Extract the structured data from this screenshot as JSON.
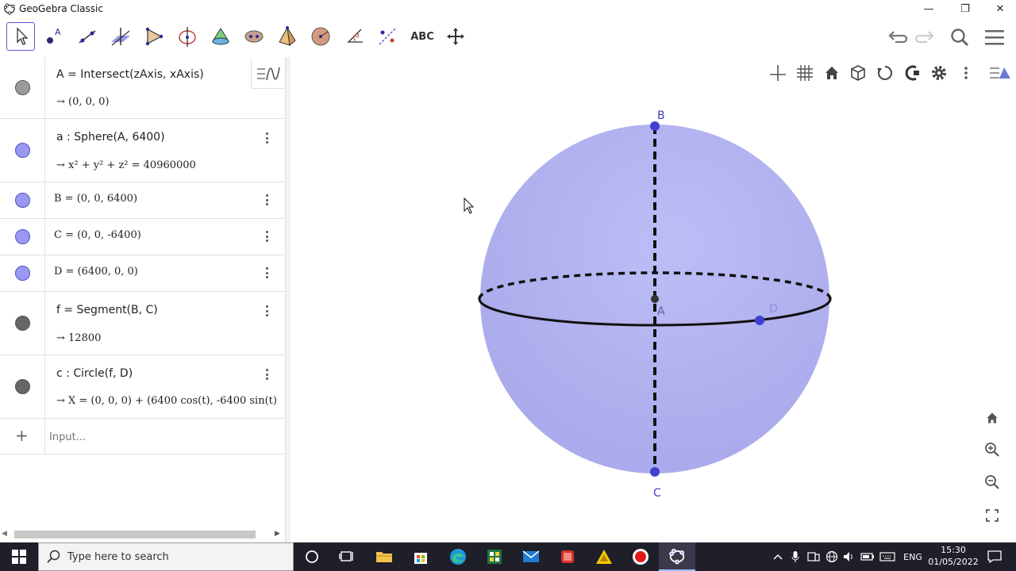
{
  "window": {
    "title": "GeoGebra Classic",
    "minimize_glyph": "—",
    "maximize_glyph": "❐",
    "close_glyph": "✕"
  },
  "toolbar": {
    "tools": [
      "move-tool",
      "point-tool",
      "line-tool",
      "perpendicular-line-tool",
      "polygon-tool",
      "circle-axis-point-tool",
      "intersect-surfaces-tool",
      "pyramid-tool",
      "sphere-tool",
      "angle-tool",
      "reflect-tool",
      "text-tool",
      "move-view-tool"
    ],
    "text_tool_label": "ABC",
    "right": [
      "undo-icon",
      "redo-icon",
      "search-icon",
      "menu-icon"
    ]
  },
  "algebra": {
    "rows": [
      {
        "definition": "A = Intersect(zAxis, xAxis)",
        "value": "→ (0, 0, 0)",
        "marble": "gray"
      },
      {
        "definition": "a : Sphere(A, 6400)",
        "value": "→ x² + y² + z² = 40960000",
        "marble": "blue"
      },
      {
        "definition": "B = (0, 0, 6400)",
        "marble": "blue"
      },
      {
        "definition": "C = (0, 0, -6400)",
        "marble": "blue"
      },
      {
        "definition": "D = (6400, 0, 0)",
        "marble": "blue"
      },
      {
        "definition": "f = Segment(B, C)",
        "value": "→ 12800",
        "marble": "dark"
      },
      {
        "definition": "c : Circle(f, D)",
        "value": "→ X = (0, 0, 0) + (6400 cos(t), -6400 sin(t)",
        "marble": "dark"
      }
    ],
    "input_placeholder": "Input...",
    "add_glyph": "+"
  },
  "graphics": {
    "labels": {
      "B": "B",
      "A": "A",
      "C": "C",
      "D": "D"
    },
    "sphere_color": "#b0b0ee",
    "point_color": "#4040d0"
  },
  "taskbar": {
    "search_placeholder": "Type here to search",
    "language": "ENG",
    "time": "15:30",
    "date": "01/05/2022"
  }
}
